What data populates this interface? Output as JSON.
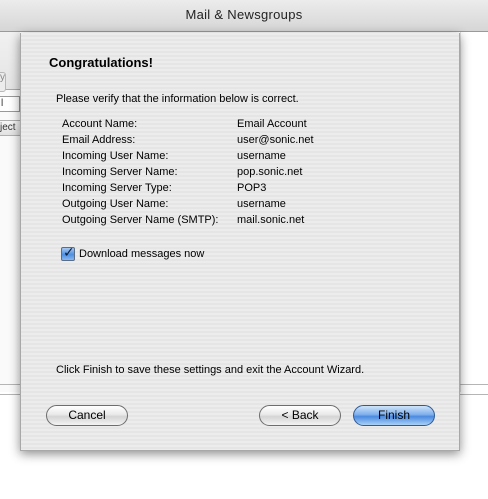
{
  "window": {
    "title": "Mail & Newsgroups",
    "partial_toolbar_text": "y",
    "partial_field_text": "l",
    "partial_column_text": "ject"
  },
  "dialog": {
    "heading": "Congratulations!",
    "intro": "Please verify that the information below is correct.",
    "info": [
      {
        "label": "Account Name:",
        "value": "Email Account"
      },
      {
        "label": "Email Address:",
        "value": "user@sonic.net"
      },
      {
        "label": "Incoming User Name:",
        "value": "username"
      },
      {
        "label": "Incoming Server Name:",
        "value": "pop.sonic.net"
      },
      {
        "label": "Incoming Server Type:",
        "value": "POP3"
      },
      {
        "label": "Outgoing User Name:",
        "value": "username"
      },
      {
        "label": "Outgoing Server Name (SMTP):",
        "value": "mail.sonic.net"
      }
    ],
    "download_checkbox": {
      "label": "Download messages now",
      "checked": true,
      "mark": "✓"
    },
    "footer_note": "Click Finish to save these settings and exit the Account Wizard.",
    "buttons": {
      "cancel": "Cancel",
      "back": "< Back",
      "finish": "Finish"
    },
    "accent_color": "#4b8ae0"
  }
}
